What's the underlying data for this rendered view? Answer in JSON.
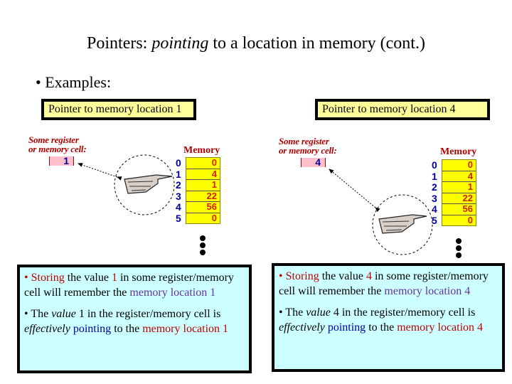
{
  "slide": {
    "title_prefix": "Pointers: ",
    "title_em": "pointing",
    "title_suffix": " to a location in memory (cont.)",
    "bullet": "• Examples:"
  },
  "examples": [
    {
      "label": "Pointer to memory location 1",
      "register_caption_line1": "Some register",
      "register_caption_line2": "or memory cell:",
      "register_value": "1",
      "memory_title": "Memory",
      "addresses": [
        "0",
        "1",
        "2",
        "3",
        "4",
        "5"
      ],
      "memory_values": [
        "0",
        "4",
        "1",
        "22",
        "56",
        "0"
      ],
      "pointed_address": "1",
      "para1": {
        "bullet": "• ",
        "storing": "Storing",
        "t1": " the value ",
        "value": "1",
        "t2": " in some register/memory cell will remember the ",
        "loc": "memory location 1"
      },
      "para2": {
        "t1": "• The ",
        "value_word": "value",
        "t2": " 1 in the register/memory cell is ",
        "effectively": "effectively",
        "t3": " ",
        "pointing": "pointing",
        "t4": " to the ",
        "loc": "memory location 1"
      }
    },
    {
      "label": "Pointer to memory location 4",
      "register_caption_line1": "Some register",
      "register_caption_line2": "or memory cell:",
      "register_value": "4",
      "memory_title": "Memory",
      "addresses": [
        "0",
        "1",
        "2",
        "3",
        "4",
        "5"
      ],
      "memory_values": [
        "0",
        "4",
        "1",
        "22",
        "56",
        "0"
      ],
      "pointed_address": "4",
      "para1": {
        "bullet": "• ",
        "storing": "Storing",
        "t1": " the value ",
        "value": "4",
        "t2": " in some register/memory cell will remember the ",
        "loc": "memory location 4"
      },
      "para2": {
        "t1": "• The ",
        "value_word": "value",
        "t2": " 4 in the register/memory cell is ",
        "effectively": "effectively",
        "t3": " ",
        "pointing": "pointing",
        "t4": " to the ",
        "loc": "memory location 4"
      }
    }
  ]
}
